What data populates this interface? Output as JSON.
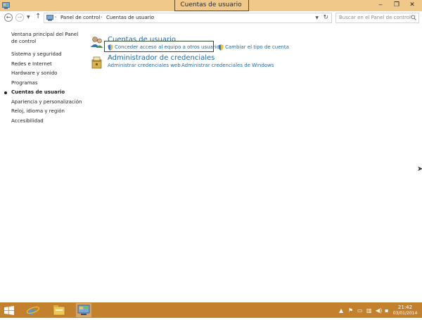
{
  "window": {
    "title": "Cuentas de usuario",
    "minimize_glyph": "‒",
    "maximize_glyph": "❐",
    "close_glyph": "✕"
  },
  "address": {
    "crumbs": [
      "Panel de control",
      "Cuentas de usuario"
    ],
    "separator": "›",
    "search_placeholder": "Buscar en el Panel de control"
  },
  "sidebar": {
    "home_link": "Ventana principal del Panel de control",
    "items": [
      {
        "label": "Sistema y seguridad"
      },
      {
        "label": "Redes e Internet"
      },
      {
        "label": "Hardware y sonido"
      },
      {
        "label": "Programas"
      },
      {
        "label": "Cuentas de usuario",
        "active": true
      },
      {
        "label": "Apariencia y personalización"
      },
      {
        "label": "Reloj, idioma y región"
      },
      {
        "label": "Accesibilidad"
      }
    ]
  },
  "sections": {
    "user_accounts": {
      "title": "Cuentas de usuario",
      "links": [
        "Conceder acceso al equipo a otros usuarios",
        "Cambiar el tipo de cuenta"
      ]
    },
    "credentials": {
      "title": "Administrador de credenciales",
      "links": [
        "Administrar credenciales web",
        "Administrar credenciales de Windows"
      ]
    }
  },
  "taskbar": {
    "time": "21:42",
    "date": "03/01/2014"
  },
  "icons": {
    "app": "control-panel-icon",
    "back": "back-arrow-icon",
    "forward": "forward-arrow-icon",
    "up": "up-arrow-icon",
    "refresh": "refresh-icon",
    "search": "search-icon",
    "shield": "uac-shield-icon"
  },
  "colors": {
    "title_bar": "#f0c98a",
    "link": "#1c6aa8",
    "taskbar": "#c4812d"
  }
}
